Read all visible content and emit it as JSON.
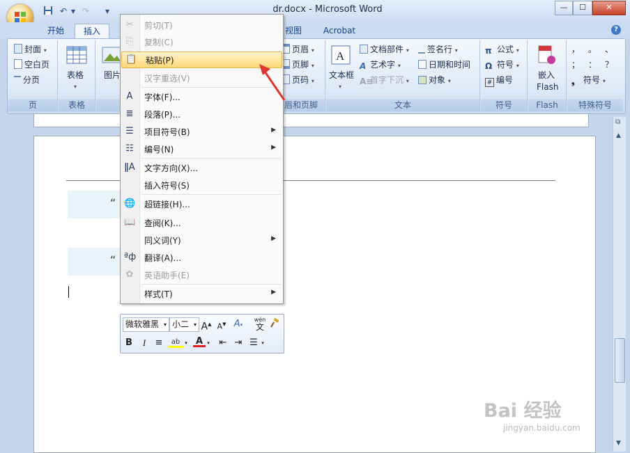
{
  "window": {
    "title": "dr.docx - Microsoft Word",
    "controls": {
      "minimize": "—",
      "maximize": "☐",
      "close": "✕"
    }
  },
  "quick_access": {
    "undo_symbol": "↶",
    "redo_symbol": "↷",
    "more_symbol": "▾"
  },
  "tabs": [
    {
      "label": "开始",
      "active": false
    },
    {
      "label": "插入",
      "active": true
    },
    {
      "label": "视图",
      "active": false
    },
    {
      "label": "Acrobat",
      "active": false
    }
  ],
  "help_label": "?",
  "ribbon": {
    "page_group": {
      "label": "页",
      "items": [
        "封面",
        "空白页",
        "分页"
      ]
    },
    "table_group": {
      "label": "表格",
      "button": "表格"
    },
    "illustrations_partial": {
      "button": "图片"
    },
    "header_footer_group": {
      "label": "眉和页脚",
      "items": [
        "页眉",
        "页脚",
        "页码"
      ]
    },
    "text_group": {
      "label": "文本",
      "textbox": "文本框",
      "items": [
        "文档部件",
        "艺术字",
        "首字下沉",
        "签名行",
        "日期和时间",
        "对象"
      ]
    },
    "symbols_group": {
      "label": "符号",
      "items": [
        "公式",
        "符号",
        "编号"
      ]
    },
    "flash_group": {
      "label": "Flash",
      "button_line1": "嵌入",
      "button_line2": "Flash"
    },
    "special_group": {
      "label": "特殊符号",
      "symbols_row1": [
        "，",
        "。",
        "、"
      ],
      "symbols_row2": [
        "；",
        "：",
        "？"
      ],
      "symbol_button": "符号"
    }
  },
  "document": {
    "quote_marks": [
      "“",
      "“"
    ]
  },
  "context_menu": {
    "items": [
      {
        "label": "剪切(T)",
        "icon": "scissors-icon",
        "glyph": "✂",
        "disabled": true,
        "submenu": false
      },
      {
        "label": "复制(C)",
        "icon": "copy-icon",
        "glyph": "⎘",
        "disabled": true,
        "submenu": false
      },
      {
        "label": "粘贴(P)",
        "icon": "paste-icon",
        "glyph": "📋",
        "disabled": false,
        "submenu": false,
        "highlighted": true
      },
      {
        "label": "汉字重选(V)",
        "icon": "",
        "glyph": "",
        "disabled": true,
        "submenu": false
      },
      {
        "label": "字体(F)...",
        "icon": "font-icon",
        "glyph": "A",
        "disabled": false,
        "submenu": false
      },
      {
        "label": "段落(P)...",
        "icon": "paragraph-icon",
        "glyph": "≣",
        "disabled": false,
        "submenu": false
      },
      {
        "label": "项目符号(B)",
        "icon": "bullets-icon",
        "glyph": "☰",
        "disabled": false,
        "submenu": true
      },
      {
        "label": "编号(N)",
        "icon": "numbering-icon",
        "glyph": "☷",
        "disabled": false,
        "submenu": true
      },
      {
        "label": "文字方向(X)...",
        "icon": "text-direction-icon",
        "glyph": "ǁA",
        "disabled": false,
        "submenu": false
      },
      {
        "label": "插入符号(S)",
        "icon": "",
        "glyph": "",
        "disabled": false,
        "submenu": false
      },
      {
        "label": "超链接(H)...",
        "icon": "hyperlink-icon",
        "glyph": "🌐",
        "disabled": false,
        "submenu": false
      },
      {
        "label": "查阅(K)...",
        "icon": "research-icon",
        "glyph": "📖",
        "disabled": false,
        "submenu": false
      },
      {
        "label": "同义词(Y)",
        "icon": "",
        "glyph": "",
        "disabled": false,
        "submenu": true
      },
      {
        "label": "翻译(A)...",
        "icon": "translate-icon",
        "glyph": "ªф",
        "disabled": false,
        "submenu": false
      },
      {
        "label": "英语助手(E)",
        "icon": "english-assistant-icon",
        "glyph": "✿",
        "disabled": true,
        "submenu": false
      },
      {
        "label": "样式(T)",
        "icon": "",
        "glyph": "",
        "disabled": false,
        "submenu": true
      }
    ]
  },
  "mini_toolbar": {
    "font": "微软雅黑",
    "size": "小二",
    "grow_font": "A",
    "shrink_font": "A",
    "styles_glyph": "A",
    "phonetic_top": "wén",
    "phonetic_char": "文",
    "bold": "B",
    "italic": "I",
    "center": "≡",
    "highlight": "ab",
    "font_color": "A",
    "outdent": "⇤",
    "indent": "⇥",
    "bullets": "☰"
  },
  "colors": {
    "highlight": "#ffd97a",
    "arrow": "#e0352b",
    "font_color_bar": "#e02020",
    "highlight_bar": "#ffff00"
  },
  "watermark": {
    "text": "Bai 经验",
    "url": "jingyan.baidu.com"
  }
}
